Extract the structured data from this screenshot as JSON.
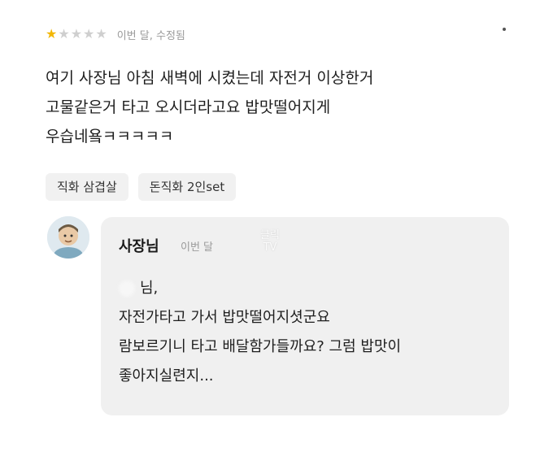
{
  "review": {
    "rating": 1,
    "max_rating": 5,
    "date": "이번 달, 수정됨",
    "lines": [
      "여기 사장님 아침 새벽에 시켰는데 자전거 이상한거",
      "고물같은거 타고 오시더라고요 밥맛떨어지게",
      "우습네욬ㅋㅋㅋㅋㅋ"
    ],
    "tags": [
      "직화 삼겹살",
      "돈직화 2인set"
    ]
  },
  "reply": {
    "author": "사장님",
    "date": "이번 달",
    "lines": [
      "님,",
      "자전가타고 가서 밥맛떨어지셧군요",
      "람보르기니 타고 배달함가들까요? 그럼 밥맛이",
      "좋아지실련지..."
    ]
  },
  "watermark": {
    "line1": "클릭",
    "line2": "TV"
  },
  "icons": {
    "star": "star-icon",
    "more": "more-dot-icon",
    "avatar": "owner-avatar"
  },
  "colors": {
    "star_filled": "#f2b705",
    "star_empty": "#cfcfcf",
    "bubble_bg": "#f0f0f0",
    "tag_bg": "#f1f1f1"
  }
}
